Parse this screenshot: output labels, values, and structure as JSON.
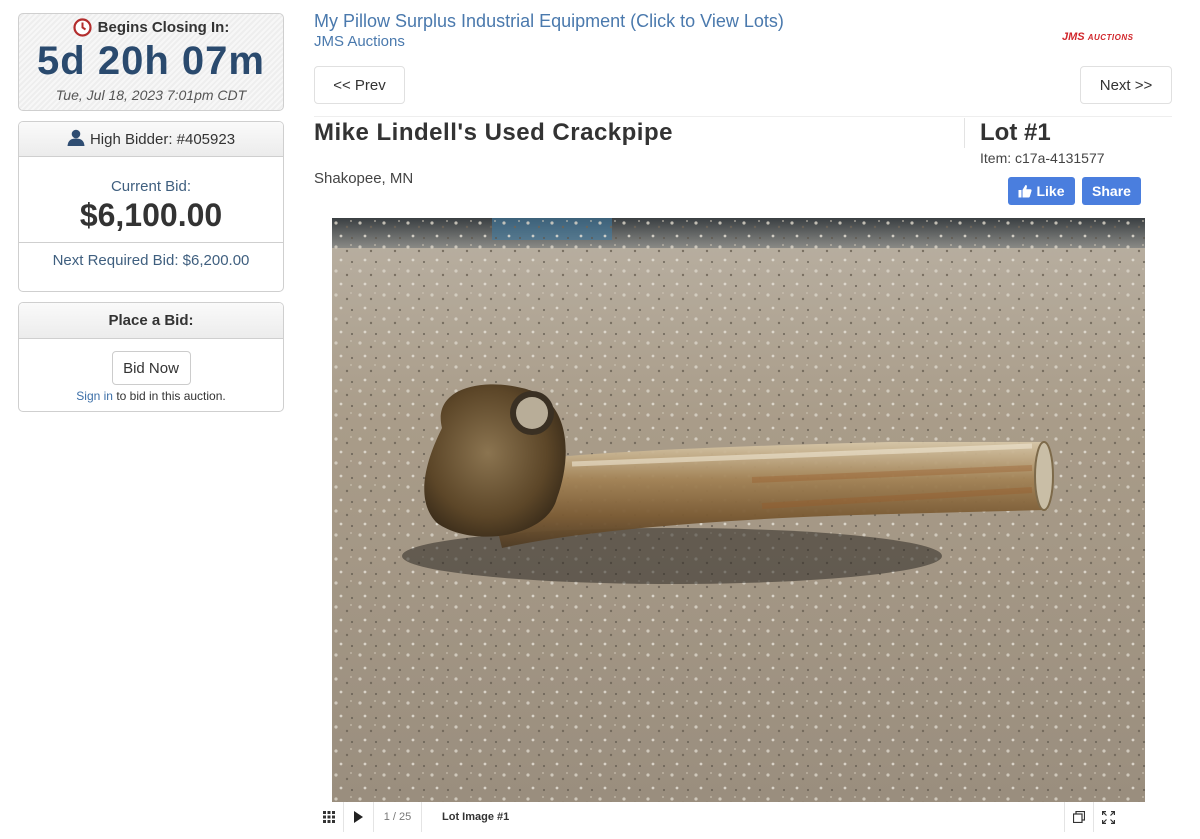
{
  "countdown": {
    "heading": "Begins Closing In:",
    "timer": "5d 20h 07m",
    "date": "Tue, Jul 18, 2023 7:01pm CDT",
    "icon": "clock-icon",
    "icon_color": "#b32d2d"
  },
  "bid": {
    "high_bidder": "High Bidder: #405923",
    "current_label": "Current Bid:",
    "current_value": "$6,100.00",
    "next_required": "Next Required Bid: $6,200.00"
  },
  "place": {
    "heading": "Place a Bid:",
    "button": "Bid Now",
    "sign_in_link": "Sign in",
    "sign_in_rest": " to bid in this auction."
  },
  "auction": {
    "title": "My Pillow Surplus Industrial Equipment (Click to View Lots)",
    "house": "JMS Auctions",
    "logo_main": "JMS",
    "logo_sub": "AUCTIONS",
    "brand_color": "#d1262b"
  },
  "nav": {
    "prev": "<< Prev",
    "next": "Next >>"
  },
  "lot": {
    "title": "Mike Lindell's Used Crackpipe",
    "location": "Shakopee, MN",
    "number": "Lot #1",
    "item": "Item: c17a-4131577"
  },
  "social": {
    "like": "Like",
    "share": "Share",
    "color": "#4a7ede"
  },
  "viewer": {
    "counter": "1 / 25",
    "caption": "Lot Image #1"
  }
}
